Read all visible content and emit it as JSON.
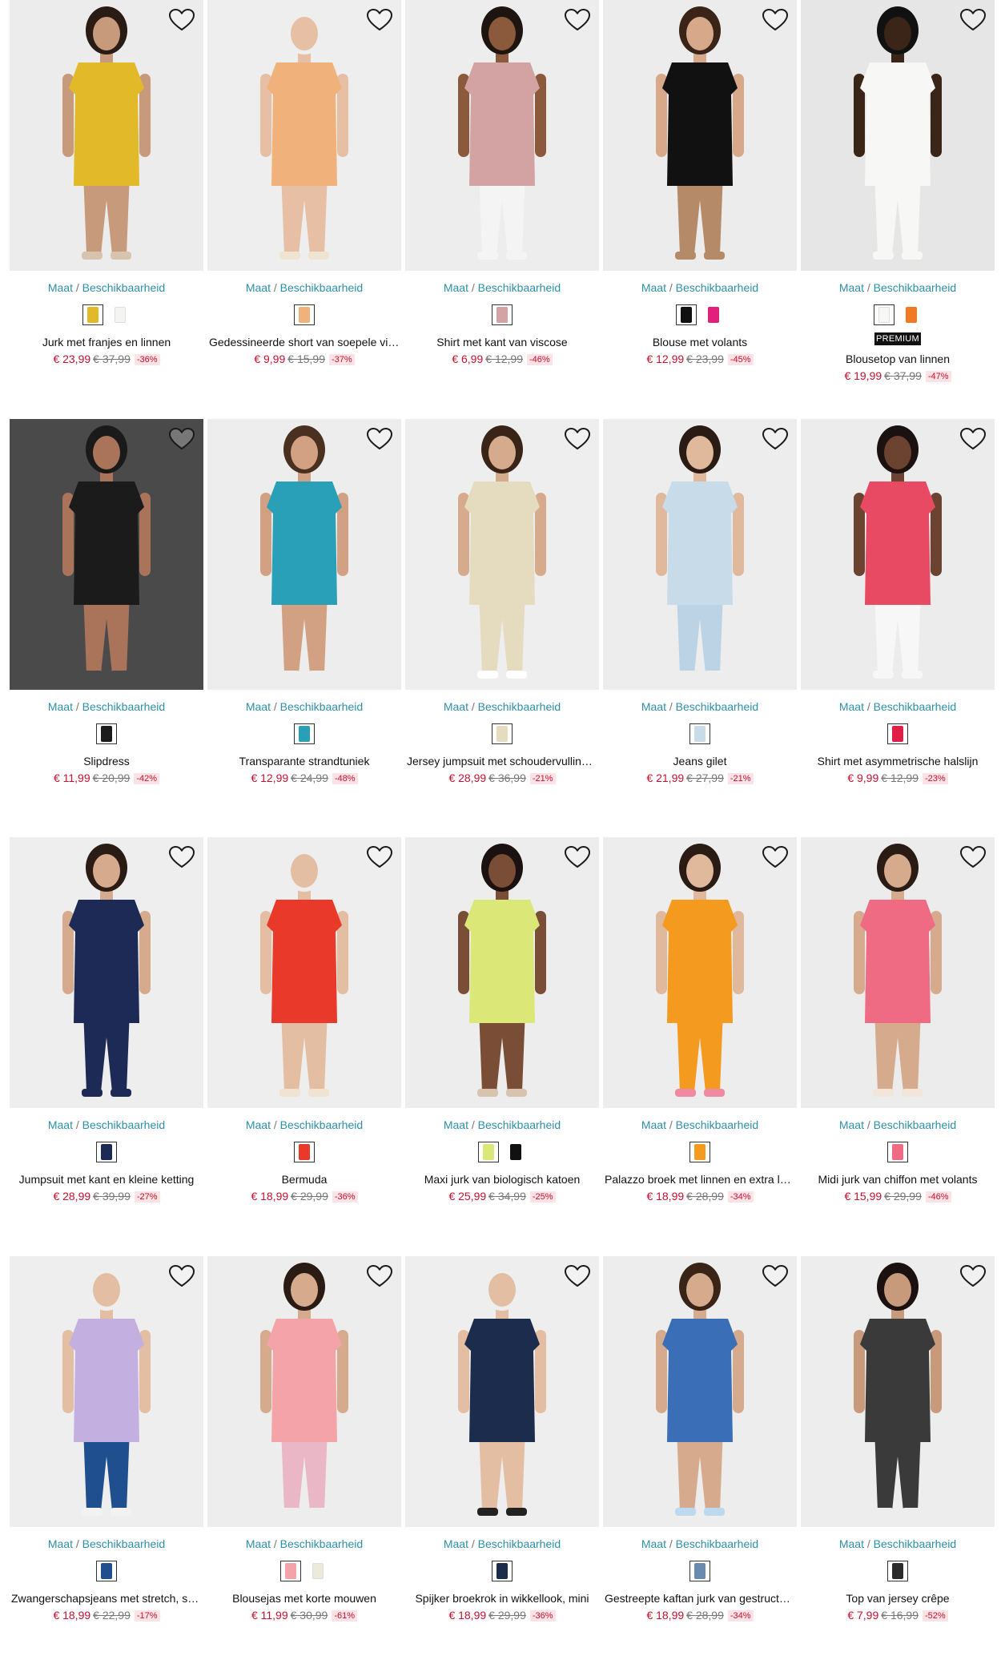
{
  "common": {
    "size_label": "Maat",
    "separator": "/",
    "availability_label": "Beschikbaarheid",
    "wishlist_icon": "heart-outline-icon"
  },
  "products": [
    {
      "name": "Jurk met franjes en linnen",
      "price": "€ 23,99",
      "old_price": "€ 37,99",
      "discount": "-36%",
      "bg": "#ececec",
      "garment": "#e2b928",
      "skin": "#c79a7c",
      "hair": "#2a1c14",
      "lower": "#c79a7c",
      "shoes": "#d8c4ae",
      "swatches": [
        "#e2b928",
        "#f4f4f2"
      ]
    },
    {
      "name": "Gedessineerde short van soepele viscose",
      "price": "€ 9,99",
      "old_price": "€ 15,99",
      "discount": "-37%",
      "bg": "#eeeeee",
      "garment": "#f0b27a",
      "skin": "#e6bfa5",
      "hair": "#eeeeee",
      "lower": "#e6bfa5",
      "shoes": "#efe3d2",
      "swatches": [
        "#f0b27a"
      ]
    },
    {
      "name": "Shirt met kant van viscose",
      "price": "€ 6,99",
      "old_price": "€ 12,99",
      "discount": "-46%",
      "bg": "#ededed",
      "garment": "#d3a3a3",
      "skin": "#8b5a3c",
      "hair": "#1f1510",
      "lower": "#f4f4f4",
      "shoes": "#f4f4f4",
      "swatches": [
        "#d3a3a3"
      ]
    },
    {
      "name": "Blouse met volants",
      "price": "€ 12,99",
      "old_price": "€ 23,99",
      "discount": "-45%",
      "bg": "#ececec",
      "garment": "#111111",
      "skin": "#d7a98a",
      "hair": "#3a2418",
      "lower": "#b58a68",
      "shoes": "#b58a68",
      "swatches": [
        "#111111",
        "#e0207a"
      ]
    },
    {
      "name": "Blousetop van linnen",
      "badge": "PREMIUM",
      "price": "€ 19,99",
      "old_price": "€ 37,99",
      "discount": "-47%",
      "bg": "#e6e6e6",
      "garment": "#f7f7f5",
      "skin": "#3b2418",
      "hair": "#111111",
      "lower": "#f7f7f5",
      "shoes": "#f7f7f5",
      "swatches": [
        "#f7f7f5",
        "#f07a24"
      ]
    },
    {
      "name": "Slipdress",
      "price": "€ 11,99",
      "old_price": "€ 20,99",
      "discount": "-42%",
      "bg": "#4a4a4a",
      "garment": "#1b1b1b",
      "skin": "#a9745a",
      "hair": "#1a1a1a",
      "lower": "#a9745a",
      "shoes": "#4a4a4a",
      "swatches": [
        "#1b1b1b"
      ]
    },
    {
      "name": "Transparante strandtuniek",
      "price": "€ 12,99",
      "old_price": "€ 24,99",
      "discount": "-48%",
      "bg": "#ededed",
      "garment": "#2aa0b8",
      "skin": "#d2a184",
      "hair": "#4a3020",
      "lower": "#d2a184",
      "shoes": "#ededed",
      "swatches": [
        "#2aa0b8"
      ]
    },
    {
      "name": "Jersey jumpsuit met schoudervullingen",
      "price": "€ 28,99",
      "old_price": "€ 36,99",
      "discount": "-21%",
      "bg": "#eeeeee",
      "garment": "#e5dcc0",
      "skin": "#d6ab8d",
      "hair": "#3a2418",
      "lower": "#e5dcc0",
      "shoes": "#ffffff",
      "swatches": [
        "#e5dcc0"
      ]
    },
    {
      "name": "Jeans gilet",
      "price": "€ 21,99",
      "old_price": "€ 27,99",
      "discount": "-21%",
      "bg": "#ededed",
      "garment": "#c7dbe9",
      "skin": "#e0b89c",
      "hair": "#2a1c14",
      "lower": "#bcd3e6",
      "shoes": "#ededed",
      "swatches": [
        "#c7dbe9"
      ]
    },
    {
      "name": "Shirt met asymmetrische halslijn",
      "price": "€ 9,99",
      "old_price": "€ 12,99",
      "discount": "-23%",
      "bg": "#ececec",
      "garment": "#e84a64",
      "skin": "#6b4330",
      "hair": "#1a1110",
      "lower": "#f7f7f7",
      "shoes": "#f7f7f7",
      "swatches": [
        "#e01e48"
      ]
    },
    {
      "name": "Jumpsuit met kant en kleine ketting",
      "price": "€ 28,99",
      "old_price": "€ 39,99",
      "discount": "-27%",
      "bg": "#eeeeee",
      "garment": "#1d2a55",
      "skin": "#d6ab8d",
      "hair": "#2a1c14",
      "lower": "#1d2a55",
      "shoes": "#1d2a55",
      "swatches": [
        "#1d2a55"
      ]
    },
    {
      "name": "Bermuda",
      "price": "€ 18,99",
      "old_price": "€ 29,99",
      "discount": "-36%",
      "bg": "#eeeeee",
      "garment": "#e8392a",
      "skin": "#e3bea3",
      "hair": "#eeeeee",
      "lower": "#e3bea3",
      "shoes": "#efe3d2",
      "swatches": [
        "#e8392a"
      ]
    },
    {
      "name": "Maxi jurk van biologisch katoen",
      "price": "€ 25,99",
      "old_price": "€ 34,99",
      "discount": "-25%",
      "bg": "#ededed",
      "garment": "#dbe877",
      "skin": "#7a4e36",
      "hair": "#1a1110",
      "lower": "#7a4e36",
      "shoes": "#d8c4ae",
      "swatches": [
        "#dbe877",
        "#111111"
      ]
    },
    {
      "name": "Palazzo broek met linnen en extra lange pijpen",
      "price": "€ 18,99",
      "old_price": "€ 28,99",
      "discount": "-34%",
      "bg": "#ededed",
      "garment": "#f39a1f",
      "skin": "#e0b89c",
      "hair": "#2a1c14",
      "lower": "#f39a1f",
      "shoes": "#f08aa0",
      "swatches": [
        "#f39a1f"
      ]
    },
    {
      "name": "Midi jurk van chiffon met volants",
      "price": "€ 15,99",
      "old_price": "€ 29,99",
      "discount": "-46%",
      "bg": "#ececec",
      "garment": "#ef6b84",
      "skin": "#d6ab8d",
      "hair": "#2a1c14",
      "lower": "#d6ab8d",
      "shoes": "#f2e6da",
      "swatches": [
        "#ef6b84"
      ]
    },
    {
      "name": "Zwangerschapsjeans met stretch, straight",
      "price": "€ 18,99",
      "old_price": "€ 22,99",
      "discount": "-17%",
      "bg": "#eeeeee",
      "garment": "#c4b0e0",
      "skin": "#e3bea3",
      "hair": "#eeeeee",
      "lower": "#1f4f8e",
      "shoes": "#f2f2f2",
      "swatches": [
        "#1f4f8e"
      ]
    },
    {
      "name": "Blousejas met korte mouwen",
      "price": "€ 11,99",
      "old_price": "€ 30,99",
      "discount": "-61%",
      "bg": "#ededed",
      "garment": "#f4a3a8",
      "skin": "#d6ab8d",
      "hair": "#2a1c14",
      "lower": "#e9b7c5",
      "shoes": "#ededed",
      "swatches": [
        "#f4a3a8",
        "#eceada"
      ]
    },
    {
      "name": "Spijker broekrok in wikkellook, mini",
      "price": "€ 18,99",
      "old_price": "€ 29,99",
      "discount": "-36%",
      "bg": "#eeeeee",
      "garment": "#1c2c4c",
      "skin": "#e3bea3",
      "hair": "#eeeeee",
      "lower": "#e3bea3",
      "shoes": "#222222",
      "swatches": [
        "#1c2c4c"
      ]
    },
    {
      "name": "Gestreepte kaftan jurk van gestructureerd katoen",
      "price": "€ 18,99",
      "old_price": "€ 28,99",
      "discount": "-34%",
      "bg": "#ededed",
      "garment": "#3a6fb8",
      "skin": "#d6ab8d",
      "hair": "#3a2418",
      "lower": "#d6ab8d",
      "shoes": "#bcd9ef",
      "swatches": [
        "#6a8ab0"
      ]
    },
    {
      "name": "Top van jersey crêpe",
      "price": "€ 7,99",
      "old_price": "€ 16,99",
      "discount": "-52%",
      "bg": "#ededed",
      "garment": "#3a3a3a",
      "skin": "#c79a7c",
      "hair": "#1a1110",
      "lower": "#3a3a3a",
      "shoes": "#ededed",
      "swatches": [
        "#2b2b2b"
      ]
    }
  ]
}
